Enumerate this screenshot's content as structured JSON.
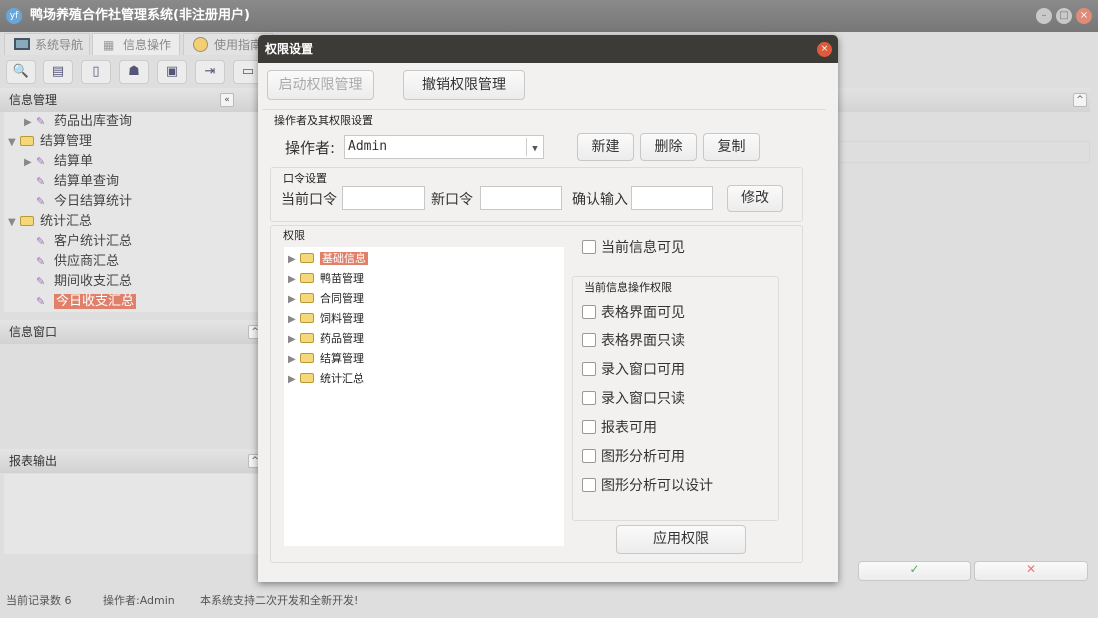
{
  "window": {
    "title": "鸭场养殖合作社管理系统(非注册用户)",
    "logo": "yf"
  },
  "tabs": [
    {
      "label": "系统导航"
    },
    {
      "label": "信息操作"
    },
    {
      "label": "使用指南"
    }
  ],
  "left": {
    "info_mgmt": "信息管理",
    "tree": [
      {
        "label": "药品出库查询",
        "level": 1,
        "arrow": "▶"
      },
      {
        "label": "结算管理",
        "level": 0,
        "arrow": "▼",
        "folder": true
      },
      {
        "label": "结算单",
        "level": 1,
        "arrow": "▶"
      },
      {
        "label": "结算单查询",
        "level": 1
      },
      {
        "label": "今日结算统计",
        "level": 1
      },
      {
        "label": "统计汇总",
        "level": 0,
        "arrow": "▼",
        "folder": true
      },
      {
        "label": "客户统计汇总",
        "level": 1
      },
      {
        "label": "供应商汇总",
        "level": 1
      },
      {
        "label": "期间收支汇总",
        "level": 1
      },
      {
        "label": "今日收支汇总",
        "level": 1,
        "selected": true
      }
    ],
    "info_window": "信息窗口",
    "report_output": "报表输出"
  },
  "status": {
    "records": "当前记录数 6",
    "operator": "操作者:Admin",
    "message": "本系统支持二次开发和全新开发!"
  },
  "dialog": {
    "title": "权限设置",
    "enable_btn": "启动权限管理",
    "revoke_btn": "撤销权限管理",
    "operator_group": "操作者及其权限设置",
    "operator_label": "操作者:",
    "operator_value": "Admin",
    "new_btn": "新建",
    "delete_btn": "删除",
    "copy_btn": "复制",
    "pwd_group": "口令设置",
    "current_pwd": "当前口令",
    "new_pwd": "新口令",
    "confirm_pwd": "确认输入",
    "modify_btn": "修改",
    "perm_group": "权限",
    "perm_tree": [
      {
        "label": "基础信息",
        "selected": true
      },
      {
        "label": "鸭苗管理"
      },
      {
        "label": "合同管理"
      },
      {
        "label": "饲料管理"
      },
      {
        "label": "药品管理"
      },
      {
        "label": "结算管理"
      },
      {
        "label": "统计汇总"
      }
    ],
    "visible_cb": "当前信息可见",
    "ops_group": "当前信息操作权限",
    "ops": [
      "表格界面可见",
      "表格界面只读",
      "录入窗口可用",
      "录入窗口只读",
      "报表可用",
      "图形分析可用",
      "图形分析可以设计"
    ],
    "apply_btn": "应用权限"
  }
}
